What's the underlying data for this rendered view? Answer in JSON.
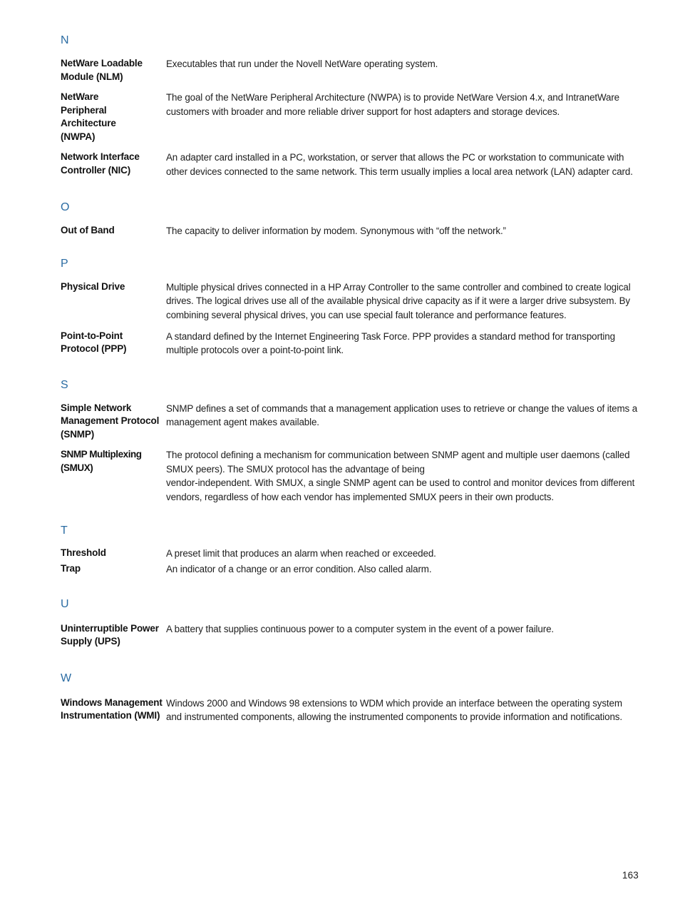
{
  "document": {
    "page_number": "163",
    "heading_color": "#2b6ca3",
    "text_color": "#1d1d1d"
  },
  "sections": [
    {
      "letter": "N",
      "entries": [
        {
          "term": "NetWare Loadable Module (NLM)",
          "definition": "Executables that run under the Novell NetWare operating system."
        },
        {
          "term": "NetWare\nPeripheral\nArchitecture\n(NWPA)",
          "definition": "The goal of the NetWare Peripheral Architecture (NWPA) is to provide NetWare Version 4.x, and IntranetWare customers with broader and more reliable driver support for host adapters and storage devices."
        },
        {
          "term": "Network Interface Controller (NIC)",
          "definition": "An adapter card installed in a PC, workstation, or server that allows the PC or workstation to communicate with other devices connected to the same network. This term usually implies a local area network (LAN) adapter card."
        }
      ]
    },
    {
      "letter": "O",
      "entries": [
        {
          "term": "Out of Band",
          "definition": "The capacity to deliver information by modem. Synonymous with “off the network.”"
        }
      ]
    },
    {
      "letter": "P",
      "entries": [
        {
          "term": "Physical Drive",
          "definition": "Multiple physical drives connected in a HP Array Controller to the same controller and combined to create logical drives. The logical drives use all of the available physical drive capacity as if it were a larger drive subsystem. By combining several physical drives, you can use special fault tolerance and performance features."
        },
        {
          "term": "Point-to-Point Protocol (PPP)",
          "definition": "A standard defined by the Internet Engineering Task Force. PPP provides a standard method for transporting multiple protocols over a point-to-point link."
        }
      ]
    },
    {
      "letter": "S",
      "entries": [
        {
          "term": "Simple Network Management Protocol (SNMP)",
          "definition": "SNMP defines a set of commands that a management application uses to retrieve or change the values of items a management agent makes available."
        },
        {
          "term": "SNMP Multiplexing (SMUX)",
          "definition": "The protocol defining a mechanism for communication between SNMP agent and multiple user daemons (called SMUX peers). The SMUX protocol has the advantage of being\nvendor-independent. With SMUX, a single SNMP agent can be used to control and monitor devices from different vendors, regardless of how each vendor has implemented SMUX peers in their own products."
        }
      ]
    },
    {
      "letter": "T",
      "entries": [
        {
          "term": "Threshold",
          "definition": "A preset limit that produces an alarm when reached or exceeded."
        },
        {
          "term": "Trap",
          "definition": "An indicator of a change or an error condition. Also called alarm."
        }
      ]
    },
    {
      "letter": "U",
      "entries": [
        {
          "term": "Uninterruptible Power Supply (UPS)",
          "definition": "A battery that supplies continuous power to a computer system in the event of a power failure."
        }
      ]
    },
    {
      "letter": "W",
      "entries": [
        {
          "term": "Windows Management Instrumentation (WMI)",
          "definition": "Windows 2000 and Windows 98 extensions to WDM which provide an interface between the operating system and instrumented components, allowing the instrumented components to provide information and notifications."
        }
      ]
    }
  ]
}
